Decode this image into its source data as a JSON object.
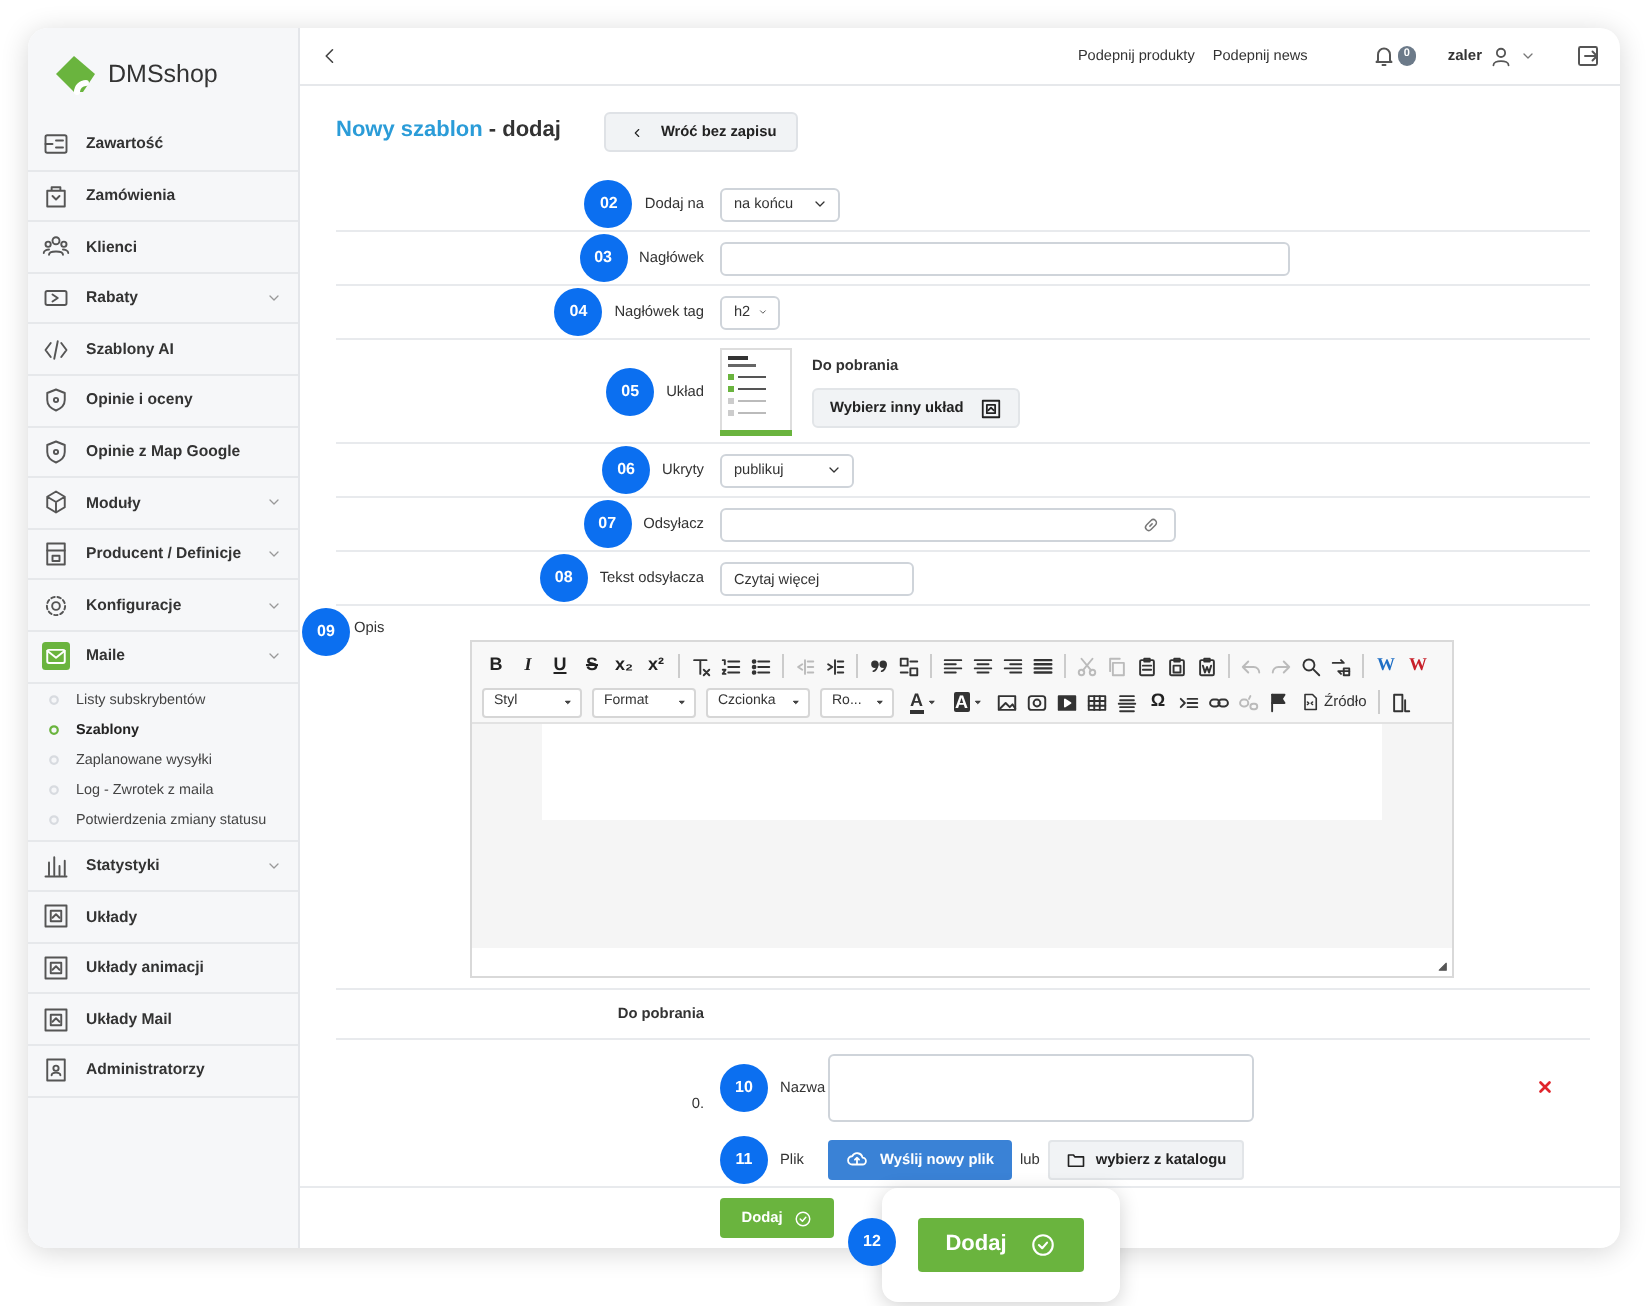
{
  "sidebar": {
    "logo": "DMSshop",
    "items": [
      {
        "label": "Zawartość",
        "kind": "content",
        "has_submenu": false,
        "selected": false
      },
      {
        "label": "Zamówienia",
        "kind": "orders",
        "has_submenu": false,
        "selected": false
      },
      {
        "label": "Klienci",
        "kind": "clients",
        "has_submenu": false,
        "selected": false
      },
      {
        "label": "Rabaty",
        "kind": "discounts",
        "has_submenu": true,
        "selected": false
      },
      {
        "label": "Szablony AI",
        "kind": "ai",
        "has_submenu": false,
        "selected": false
      },
      {
        "label": "Opinie i oceny",
        "kind": "reviews",
        "has_submenu": false,
        "selected": false
      },
      {
        "label": "Opinie z Map Google",
        "kind": "reviews",
        "has_submenu": false,
        "selected": false
      },
      {
        "label": "Moduły",
        "kind": "modules",
        "has_submenu": true,
        "selected": false
      },
      {
        "label": "Producent / Definicje",
        "kind": "producer",
        "has_submenu": true,
        "selected": false
      },
      {
        "label": "Konfiguracje",
        "kind": "config",
        "has_submenu": true,
        "selected": false
      },
      {
        "label": "Maile",
        "kind": "mail",
        "has_submenu": true,
        "selected": true,
        "children": [
          {
            "label": "Listy subskrybentów",
            "selected": false
          },
          {
            "label": "Szablony",
            "selected": true
          },
          {
            "label": "Zaplanowane wysyłki",
            "selected": false
          },
          {
            "label": "Log - Zwrotek z maila",
            "selected": false
          },
          {
            "label": "Potwierdzenia zmiany statusu",
            "selected": false
          }
        ]
      },
      {
        "label": "Statystyki",
        "kind": "stats",
        "has_submenu": true,
        "selected": false
      },
      {
        "label": "Układy",
        "kind": "layout",
        "has_submenu": false,
        "selected": false
      },
      {
        "label": "Układy animacji",
        "kind": "layout",
        "has_submenu": false,
        "selected": false
      },
      {
        "label": "Układy Mail",
        "kind": "layout",
        "has_submenu": false,
        "selected": false
      },
      {
        "label": "Administratorzy",
        "kind": "admin",
        "has_submenu": false,
        "selected": false
      }
    ]
  },
  "topbar": {
    "links": [
      "Podepnij produkty",
      "Podepnij news"
    ],
    "notifications": "0",
    "user": "zaler"
  },
  "page": {
    "title_entity": "Nowy szablon",
    "title_action": "- dodaj",
    "back_button": "Wróć bez zapisu"
  },
  "form": {
    "rows": [
      {
        "step": "02",
        "label": "Dodaj na",
        "kind": "select",
        "value": "na końcu"
      },
      {
        "step": "03",
        "label": "Nagłówek",
        "kind": "input"
      },
      {
        "step": "04",
        "label": "Nagłówek tag",
        "kind": "select",
        "value": "h2"
      },
      {
        "step": "05",
        "label": "Układ",
        "kind": "layout",
        "layout_name": "Do pobrania",
        "button": "Wybierz inny układ"
      },
      {
        "step": "06",
        "label": "Ukryty",
        "kind": "select",
        "value": "publikuj"
      },
      {
        "step": "07",
        "label": "Odsyłacz",
        "kind": "link"
      },
      {
        "step": "08",
        "label": "Tekst odsyłacza",
        "kind": "input",
        "value": "Czytaj więcej"
      }
    ]
  },
  "editor": {
    "step": "09",
    "label": "Opis",
    "toolbar_rows": [
      [
        {
          "kind": "glyph",
          "text": "B",
          "disabled": false
        },
        {
          "kind": "glyph",
          "text": "I",
          "disabled": false
        },
        {
          "kind": "glyph",
          "text": "U",
          "disabled": false
        },
        {
          "kind": "glyph",
          "text": "S",
          "disabled": false
        },
        {
          "kind": "glyph",
          "text": "x₂",
          "disabled": false
        },
        {
          "kind": "glyph",
          "text": "x²",
          "disabled": false
        },
        {
          "kind": "separator"
        },
        {
          "kind": "clear-format",
          "disabled": false
        },
        {
          "kind": "numbered-list",
          "disabled": false
        },
        {
          "kind": "bullet-list",
          "disabled": false
        },
        {
          "kind": "separator"
        },
        {
          "kind": "outdent",
          "disabled": true
        },
        {
          "kind": "indent",
          "disabled": false
        },
        {
          "kind": "separator"
        },
        {
          "kind": "quote",
          "disabled": false
        },
        {
          "kind": "div",
          "disabled": false
        },
        {
          "kind": "separator"
        },
        {
          "kind": "align-left",
          "disabled": false
        },
        {
          "kind": "align-center",
          "disabled": false
        },
        {
          "kind": "align-right",
          "disabled": false
        },
        {
          "kind": "align-justify",
          "disabled": false
        },
        {
          "kind": "separator"
        },
        {
          "kind": "cut",
          "disabled": true
        },
        {
          "kind": "copy",
          "disabled": true
        },
        {
          "kind": "paste",
          "disabled": false
        },
        {
          "kind": "paste-text",
          "disabled": false
        },
        {
          "kind": "paste-word",
          "disabled": false
        },
        {
          "kind": "separator"
        },
        {
          "kind": "undo",
          "disabled": true
        },
        {
          "kind": "redo",
          "disabled": true
        },
        {
          "kind": "search",
          "disabled": false
        },
        {
          "kind": "replace",
          "disabled": false
        },
        {
          "kind": "separator"
        },
        {
          "kind": "glyph",
          "text": "W",
          "color": "#1f6fc5",
          "disabled": false
        },
        {
          "kind": "glyph",
          "text": "W",
          "color": "#c8202a",
          "disabled": false
        }
      ],
      [
        {
          "kind": "dropdown",
          "text": "Styl",
          "disabled": false
        },
        {
          "kind": "dropdown",
          "text": "Format",
          "disabled": false
        },
        {
          "kind": "dropdown",
          "text": "Czcionka",
          "disabled": false
        },
        {
          "kind": "dropdown",
          "text": "Ro...",
          "disabled": false
        },
        {
          "kind": "text-color",
          "text": "A",
          "disabled": false
        },
        {
          "kind": "bg-color",
          "text": "A",
          "disabled": false
        },
        {
          "kind": "image",
          "disabled": false
        },
        {
          "kind": "flash",
          "disabled": false
        },
        {
          "kind": "video",
          "disabled": false
        },
        {
          "kind": "table",
          "disabled": false
        },
        {
          "kind": "hr",
          "disabled": false
        },
        {
          "kind": "glyph",
          "text": "Ω",
          "disabled": false
        },
        {
          "kind": "page-break",
          "disabled": false
        },
        {
          "kind": "link",
          "disabled": false
        },
        {
          "kind": "unlink",
          "disabled": true
        },
        {
          "kind": "anchor",
          "disabled": false
        },
        {
          "kind": "source",
          "text": "Źródło",
          "disabled": false
        },
        {
          "kind": "separator"
        },
        {
          "kind": "maximize",
          "disabled": false
        }
      ]
    ]
  },
  "attachments": {
    "title": "Do pobrania",
    "items": [
      {
        "index": "0.",
        "name_step": "10",
        "name_label": "Nazwa",
        "file_step": "11",
        "file_label": "Plik",
        "upload_button": "Wyślij nowy plik",
        "or": "lub",
        "catalog_button": "wybierz z katalogu"
      }
    ]
  },
  "footer": {
    "submit": "Dodaj"
  },
  "callout": {
    "step": "12",
    "button": "Dodaj"
  }
}
